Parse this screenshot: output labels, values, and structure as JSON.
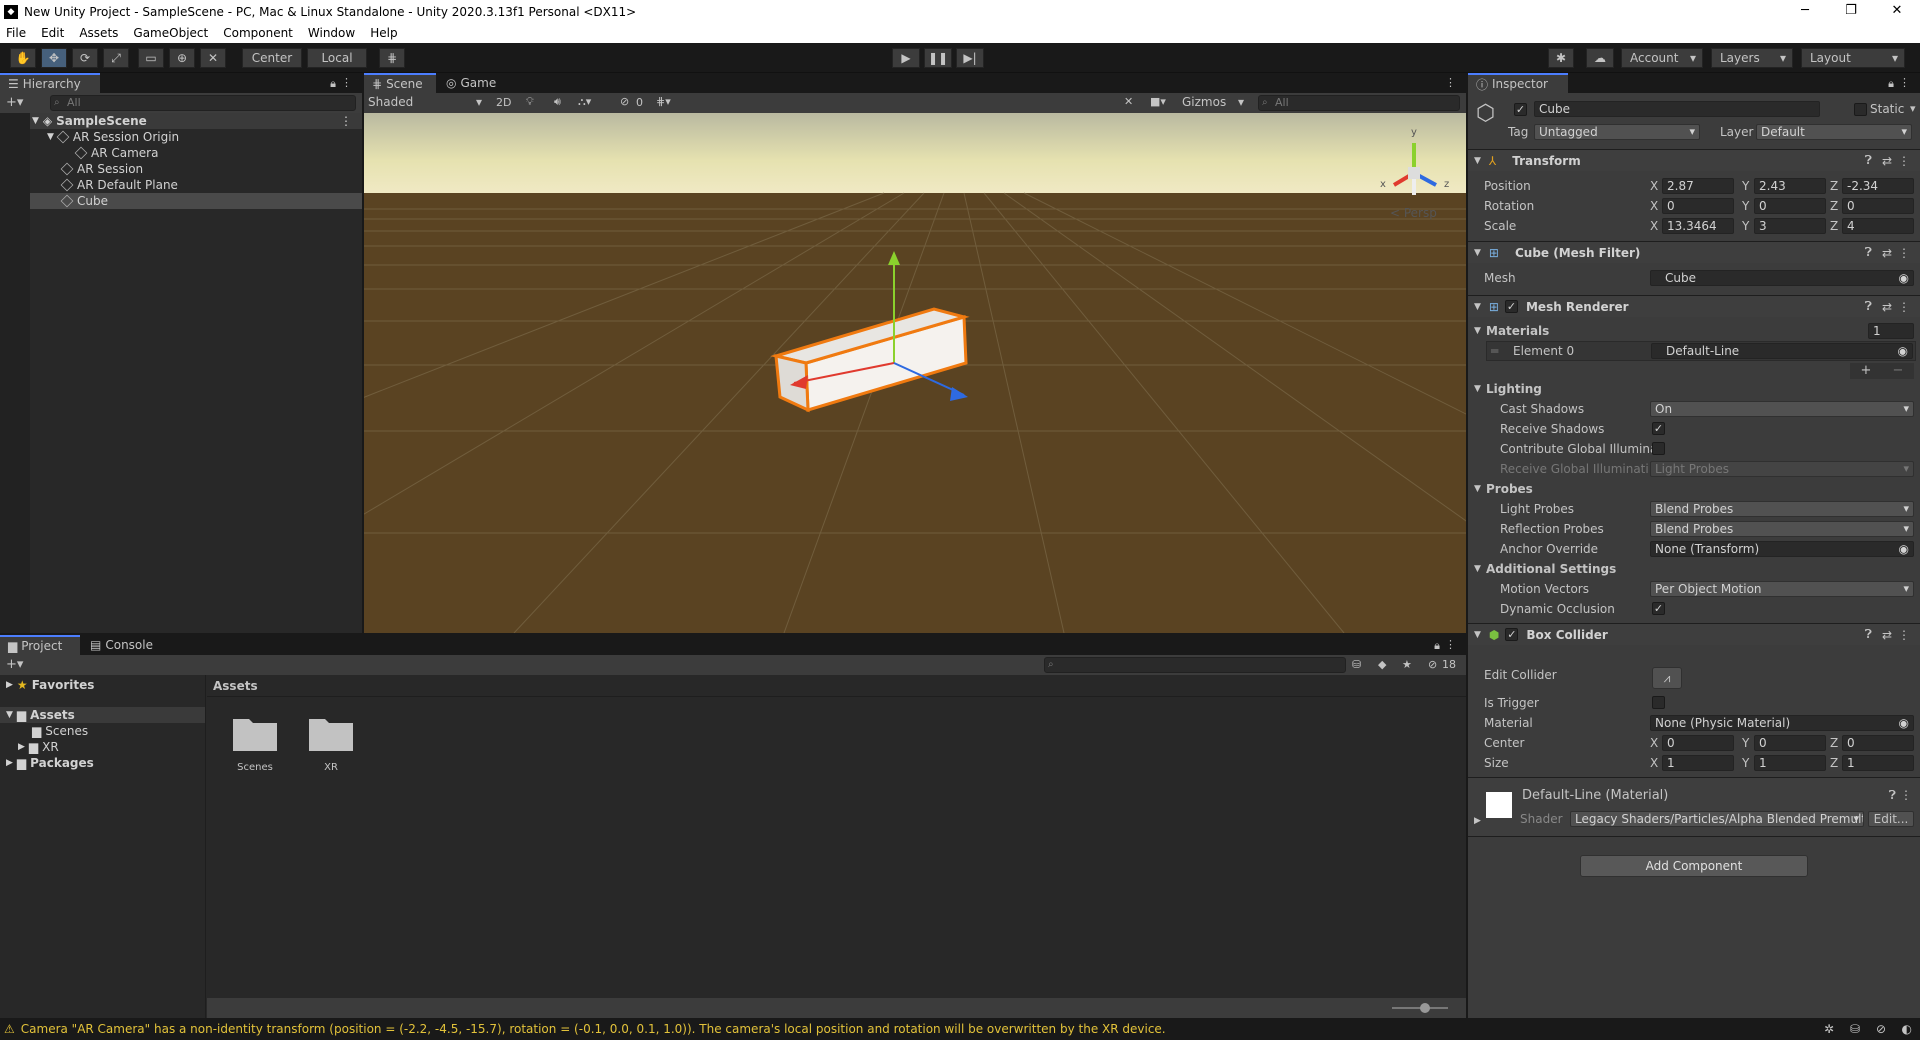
{
  "window": {
    "title": "New Unity Project - SampleScene - PC, Mac & Linux Standalone - Unity 2020.3.13f1 Personal <DX11>",
    "minimize": "─",
    "maximize": "❐",
    "close": "✕"
  },
  "menu": [
    "File",
    "Edit",
    "Assets",
    "GameObject",
    "Component",
    "Window",
    "Help"
  ],
  "toolbar": {
    "pivot": "Center",
    "space": "Local",
    "account": "Account",
    "layers": "Layers",
    "layout": "Layout"
  },
  "hierarchy": {
    "tab": "Hierarchy",
    "search_placeholder": "All",
    "scene": "SampleScene",
    "items": [
      "AR Session Origin",
      "AR Camera",
      "AR Session",
      "AR Default Plane",
      "Cube"
    ]
  },
  "scene_view": {
    "tabs": [
      "Scene",
      "Game"
    ],
    "shading": "Shaded",
    "mode2d": "2D",
    "hidden_count": "0",
    "gizmos": "Gizmos",
    "search_placeholder": "All",
    "persp": "< Persp",
    "gizmo_axes": {
      "y": "y",
      "x": "x",
      "z": "z"
    }
  },
  "project": {
    "tabs": [
      "Project",
      "Console"
    ],
    "favorites": "Favorites",
    "assets": "Assets",
    "folders": [
      "Scenes",
      "XR"
    ],
    "packages": "Packages",
    "breadcrumb": "Assets",
    "grid_items": [
      "Scenes",
      "XR"
    ],
    "count": "18"
  },
  "inspector": {
    "tab": "Inspector",
    "object_name": "Cube",
    "static": "Static",
    "tag_label": "Tag",
    "tag": "Untagged",
    "layer_label": "Layer",
    "layer": "Default",
    "transform": {
      "title": "Transform",
      "position_label": "Position",
      "position": [
        "2.87",
        "2.43",
        "-2.34"
      ],
      "rotation_label": "Rotation",
      "rotation": [
        "0",
        "0",
        "0"
      ],
      "scale_label": "Scale",
      "scale": [
        "13.3464",
        "3",
        "4"
      ]
    },
    "mesh_filter": {
      "title": "Cube (Mesh Filter)",
      "mesh_label": "Mesh",
      "mesh": "Cube"
    },
    "mesh_renderer": {
      "title": "Mesh Renderer",
      "materials_label": "Materials",
      "materials_count": "1",
      "element_label": "Element 0",
      "element_value": "Default-Line",
      "lighting": "Lighting",
      "cast_shadows_label": "Cast Shadows",
      "cast_shadows": "On",
      "receive_shadows_label": "Receive Shadows",
      "contribute_gi_label": "Contribute Global Illuminat",
      "receive_gi_label": "Receive Global Illuminatior",
      "receive_gi": "Light Probes",
      "probes": "Probes",
      "light_probes_label": "Light Probes",
      "light_probes": "Blend Probes",
      "reflection_probes_label": "Reflection Probes",
      "reflection_probes": "Blend Probes",
      "anchor_override_label": "Anchor Override",
      "anchor_override": "None (Transform)",
      "additional": "Additional Settings",
      "motion_vectors_label": "Motion Vectors",
      "motion_vectors": "Per Object Motion",
      "dynamic_occlusion_label": "Dynamic Occlusion"
    },
    "box_collider": {
      "title": "Box Collider",
      "edit_label": "Edit Collider",
      "trigger_label": "Is Trigger",
      "material_label": "Material",
      "material": "None (Physic Material)",
      "center_label": "Center",
      "center": [
        "0",
        "0",
        "0"
      ],
      "size_label": "Size",
      "size": [
        "1",
        "1",
        "1"
      ]
    },
    "material": {
      "title": "Default-Line (Material)",
      "shader_label": "Shader",
      "shader": "Legacy Shaders/Particles/Alpha Blended Premulti",
      "edit": "Edit..."
    },
    "add_component": "Add Component",
    "axis_labels": [
      "X",
      "Y",
      "Z"
    ]
  },
  "status_bar": {
    "message": "Camera \"AR Camera\" has a non-identity transform (position = (-2.2, -4.5, -15.7), rotation = (-0.1, 0.0, 0.1, 1.0)). The camera's local position and rotation will be overwritten by the XR device."
  }
}
